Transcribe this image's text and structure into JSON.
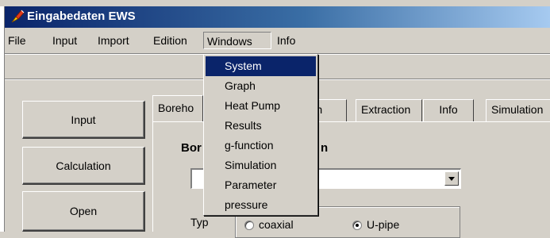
{
  "window": {
    "title": "Eingabedaten EWS"
  },
  "menubar": {
    "items": [
      "File",
      "Input",
      "Import",
      "Edition",
      "Windows",
      "Info"
    ]
  },
  "windows_menu": {
    "items": [
      "System",
      "Graph",
      "Heat Pump",
      "Results",
      "g-function",
      "Simulation",
      "Parameter",
      "pressure"
    ],
    "selected": "System"
  },
  "sidebar": {
    "buttons": [
      "Input",
      "Calculation",
      "Open"
    ]
  },
  "tabs": {
    "items": [
      "Boreho",
      "arth",
      "Extraction",
      "Info",
      "Simulation"
    ]
  },
  "borehole": {
    "section_title_left": "Bor",
    "section_title_right": "n",
    "type_label": "Typ",
    "options": [
      "coaxial",
      "U-pipe"
    ],
    "selected_option": "U-pipe"
  },
  "colors": {
    "titlebar": "#0a246a",
    "selection": "#0a246a",
    "face": "#d4d0c8"
  }
}
